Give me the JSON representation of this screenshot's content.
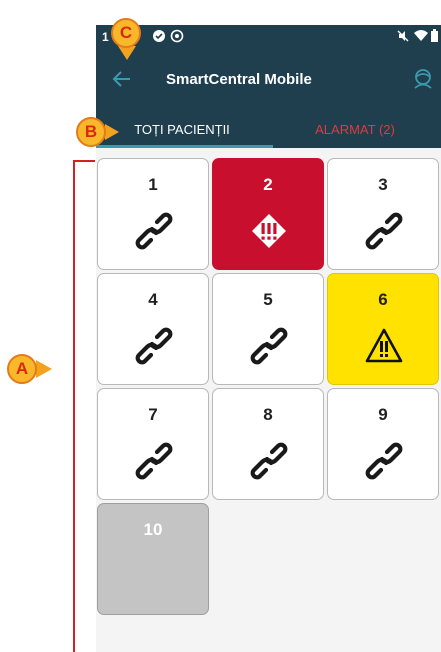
{
  "status_bar": {
    "time": "1"
  },
  "app": {
    "title": "SmartCentral Mobile"
  },
  "tabs": [
    {
      "label": "TOȚI PACIENȚII",
      "selected": true
    },
    {
      "label": "ALARMAT (2)",
      "selected": false
    }
  ],
  "beds": [
    {
      "number": "1",
      "state": "linked",
      "icon": "link-icon"
    },
    {
      "number": "2",
      "state": "alarm-high",
      "icon": "alarm-diamond-icon"
    },
    {
      "number": "3",
      "state": "linked",
      "icon": "link-icon"
    },
    {
      "number": "4",
      "state": "linked",
      "icon": "link-icon"
    },
    {
      "number": "5",
      "state": "linked",
      "icon": "link-icon"
    },
    {
      "number": "6",
      "state": "warning",
      "icon": "warning-triangle-icon"
    },
    {
      "number": "7",
      "state": "linked",
      "icon": "link-icon"
    },
    {
      "number": "8",
      "state": "linked",
      "icon": "link-icon"
    },
    {
      "number": "9",
      "state": "linked",
      "icon": "link-icon"
    },
    {
      "number": "10",
      "state": "inactive",
      "icon": ""
    }
  ],
  "callouts": {
    "a": "A",
    "b": "B",
    "c": "C"
  },
  "colors": {
    "appbar": "#1f3f4f",
    "tab_indicator": "#3a9bb0",
    "alarm_text": "#e0393e",
    "alarm_red": "#c8102e",
    "warning_yellow": "#ffe200",
    "inactive_grey": "#c4c4c4",
    "callout_fill": "#f8b82a",
    "callout_text": "#d92a10"
  }
}
